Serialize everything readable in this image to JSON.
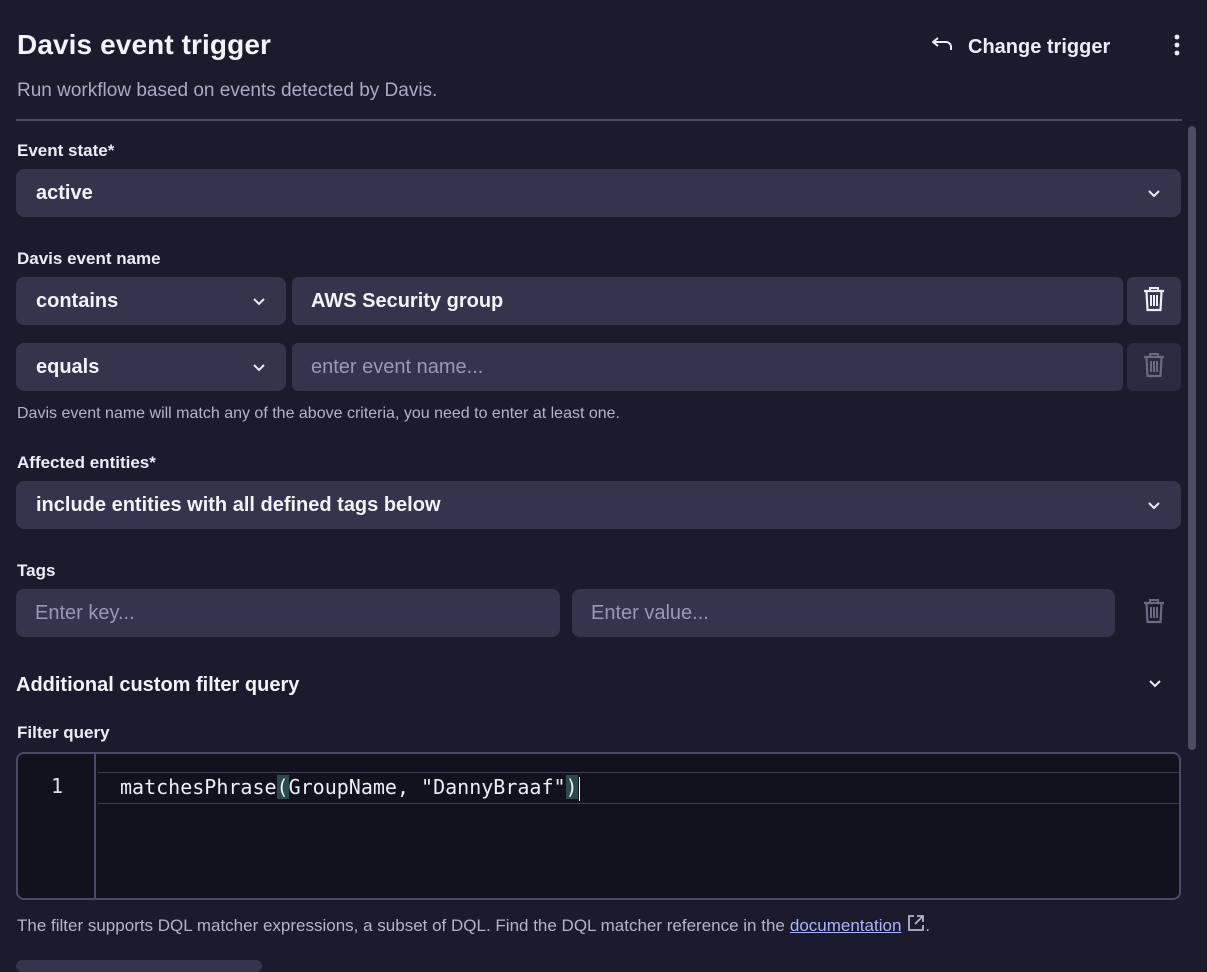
{
  "header": {
    "title": "Davis event trigger",
    "subtitle": "Run workflow based on events detected by Davis.",
    "change_trigger_label": "Change trigger"
  },
  "event_state": {
    "label": "Event state*",
    "selected": "active"
  },
  "davis_event_name": {
    "label": "Davis event name",
    "rows": [
      {
        "operator": "contains",
        "value": "AWS Security group",
        "placeholder": ""
      },
      {
        "operator": "equals",
        "value": "",
        "placeholder": "enter event name..."
      }
    ],
    "hint": "Davis event name will match any of the above criteria, you need to enter at least one."
  },
  "affected_entities": {
    "label": "Affected entities*",
    "selected": "include entities with all defined tags below"
  },
  "tags": {
    "label": "Tags",
    "key_placeholder": "Enter key...",
    "value_placeholder": "Enter value..."
  },
  "custom_filter": {
    "section_title": "Additional custom filter query",
    "label": "Filter query",
    "line_number": "1",
    "code_fn": "matchesPhrase",
    "code_open": "(",
    "code_args": "GroupName, \"DannyBraaf\"",
    "code_close": ")",
    "footer_text": "The filter supports DQL matcher expressions, a subset of DQL. Find the DQL matcher reference in the",
    "footer_link": "documentation",
    "footer_end": "."
  },
  "icons": {
    "change_trigger": "return-arrow-icon",
    "more": "more-vertical-icon",
    "dropdown": "chevron-down-icon",
    "delete": "trash-icon",
    "external": "external-link-icon"
  },
  "colors": {
    "background": "#1b1b2d",
    "field": "#34344c",
    "editor": "#12121f",
    "link": "#a8b4ff"
  }
}
